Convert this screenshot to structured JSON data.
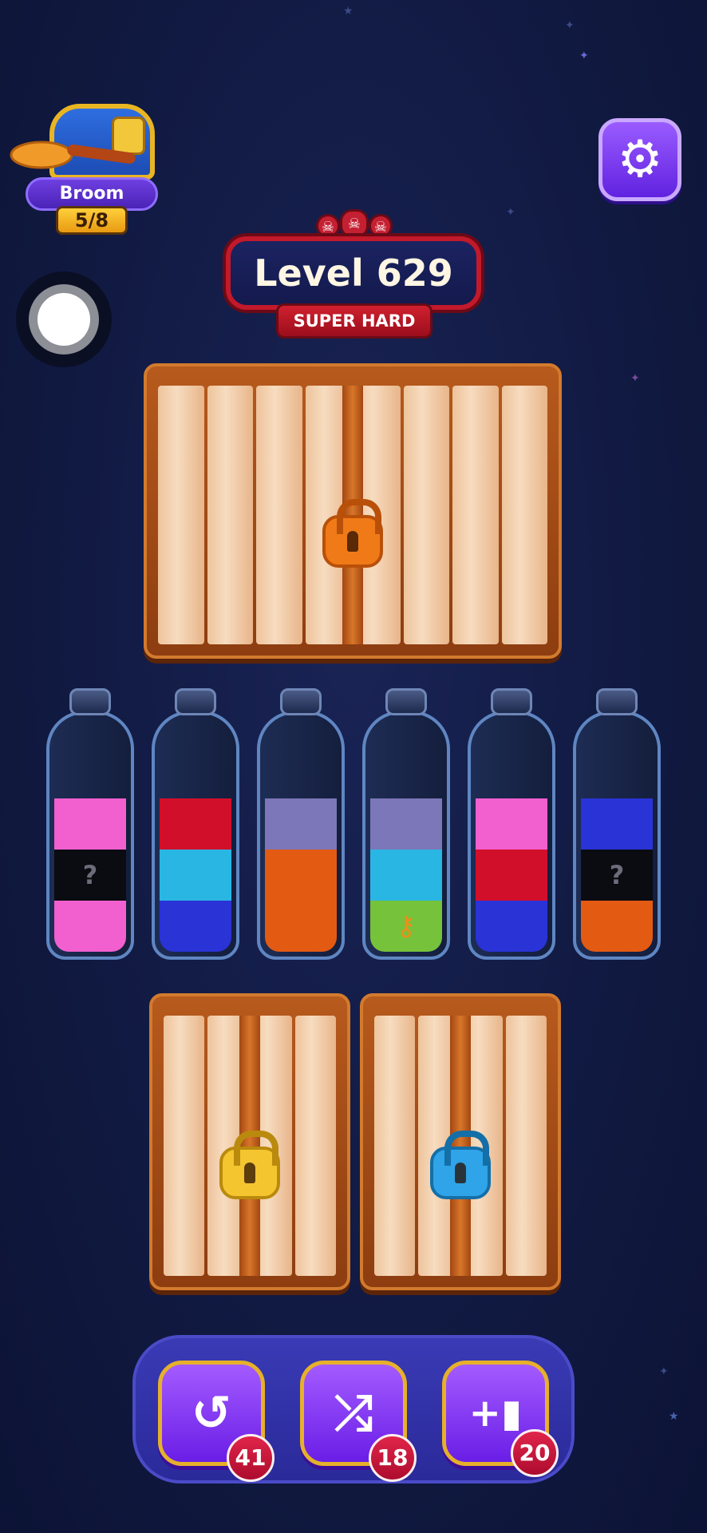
{
  "streak": {
    "title": "Broom Streak",
    "progress": "5/8"
  },
  "level": {
    "title": "Level 629",
    "difficulty": "SUPER HARD"
  },
  "icons": {
    "settings": "gear-icon",
    "skull": "skull-icon",
    "undo": "undo-icon",
    "shuffle": "shuffle-icon",
    "add_bottle": "add-bottle-icon"
  },
  "colors": {
    "pink": "#f25fcf",
    "black": "#0b0b12",
    "red": "#d20f2a",
    "cyan": "#2ab6e3",
    "blue": "#2a33d6",
    "lavender": "#7c77b8",
    "orange": "#e35a12",
    "green": "#76c23a",
    "lock_orange": "#f07a17",
    "lock_yellow": "#f5c530",
    "lock_blue": "#2fa4e8"
  },
  "bottles": [
    {
      "layers": [
        "pink",
        "black",
        "pink"
      ],
      "hidden": [
        false,
        true,
        false
      ]
    },
    {
      "layers": [
        "blue",
        "cyan",
        "red"
      ],
      "hidden": [
        false,
        false,
        false
      ]
    },
    {
      "layers": [
        "orange",
        "orange",
        "lavender"
      ],
      "hidden": [
        false,
        false,
        false
      ]
    },
    {
      "layers": [
        "green",
        "cyan",
        "lavender"
      ],
      "hidden": [
        false,
        false,
        false
      ],
      "key_in_bottom": true
    },
    {
      "layers": [
        "blue",
        "red",
        "pink"
      ],
      "hidden": [
        false,
        false,
        false
      ]
    },
    {
      "layers": [
        "orange",
        "black",
        "blue"
      ],
      "hidden": [
        false,
        true,
        false
      ]
    }
  ],
  "hidden_marker": "?",
  "locks": [
    "orange",
    "yellow",
    "blue"
  ],
  "powerups": [
    {
      "name": "undo",
      "glyph": "↺",
      "count": "41"
    },
    {
      "name": "shuffle",
      "glyph": "⤮",
      "count": "18"
    },
    {
      "name": "add-bottle",
      "glyph": "+▮",
      "count": "20"
    }
  ]
}
